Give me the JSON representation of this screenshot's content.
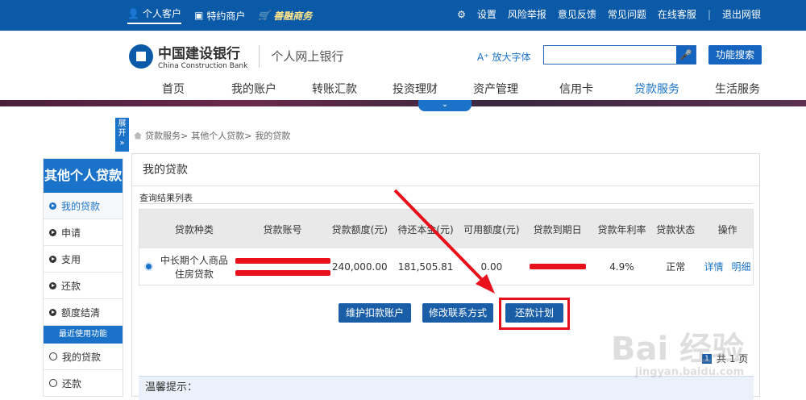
{
  "topbar": {
    "personal": "个人客户",
    "merchant": "特约商户",
    "shanrong": "善融商务",
    "settings": "设置",
    "risk": "风险举报",
    "feedback": "意见反馈",
    "faq": "常见问题",
    "service": "在线客服",
    "logout": "退出网银"
  },
  "header": {
    "bank_cn": "中国建设银行",
    "bank_en": "China Construction Bank",
    "subtitle": "个人网上银行",
    "enlarge_font": "放大字体",
    "search_placeholder": "",
    "search_button": "功能搜索"
  },
  "nav": {
    "items": [
      "首页",
      "我的账户",
      "转账汇款",
      "投资理财",
      "资产管理",
      "信用卡",
      "贷款服务",
      "生活服务"
    ],
    "active_index": 6
  },
  "expand": "展开",
  "breadcrumb": {
    "l1": "贷款服务>",
    "l2": "其他个人贷款>",
    "l3": "我的贷款"
  },
  "sidebar": {
    "title": "其他个人贷款",
    "items": [
      "我的贷款",
      "申请",
      "支用",
      "还款",
      "额度结清"
    ],
    "recent_label": "最近使用功能",
    "recent_items": [
      "我的贷款",
      "还款"
    ]
  },
  "panel": {
    "title": "我的贷款",
    "list_title": "查询结果列表",
    "headers": [
      "贷款种类",
      "贷款账号",
      "贷款额度(元)",
      "待还本金(元)",
      "可用额度(元)",
      "贷款到期日",
      "贷款年利率",
      "贷款状态",
      "操作"
    ],
    "row": {
      "type_line1": "中长期个人商品",
      "type_line2": "住房贷款",
      "amount": "240,000.00",
      "principal": "181,505.81",
      "available": "0.00",
      "rate": "4.9%",
      "status": "正常",
      "detail": "详情",
      "breakdown": "明细"
    },
    "buttons": {
      "maintain": "维护扣款账户",
      "contact": "修改联系方式",
      "plan": "还款计划"
    },
    "pager": {
      "page": "1",
      "total": "共 1 页"
    },
    "tip": "温馨提示："
  },
  "watermark": {
    "brand": "Bai 经验",
    "url": "jingyan.baidu.com"
  },
  "colors": {
    "primary": "#0b5aa8",
    "accent": "#1a73c9",
    "highlight": "#e8101a"
  }
}
